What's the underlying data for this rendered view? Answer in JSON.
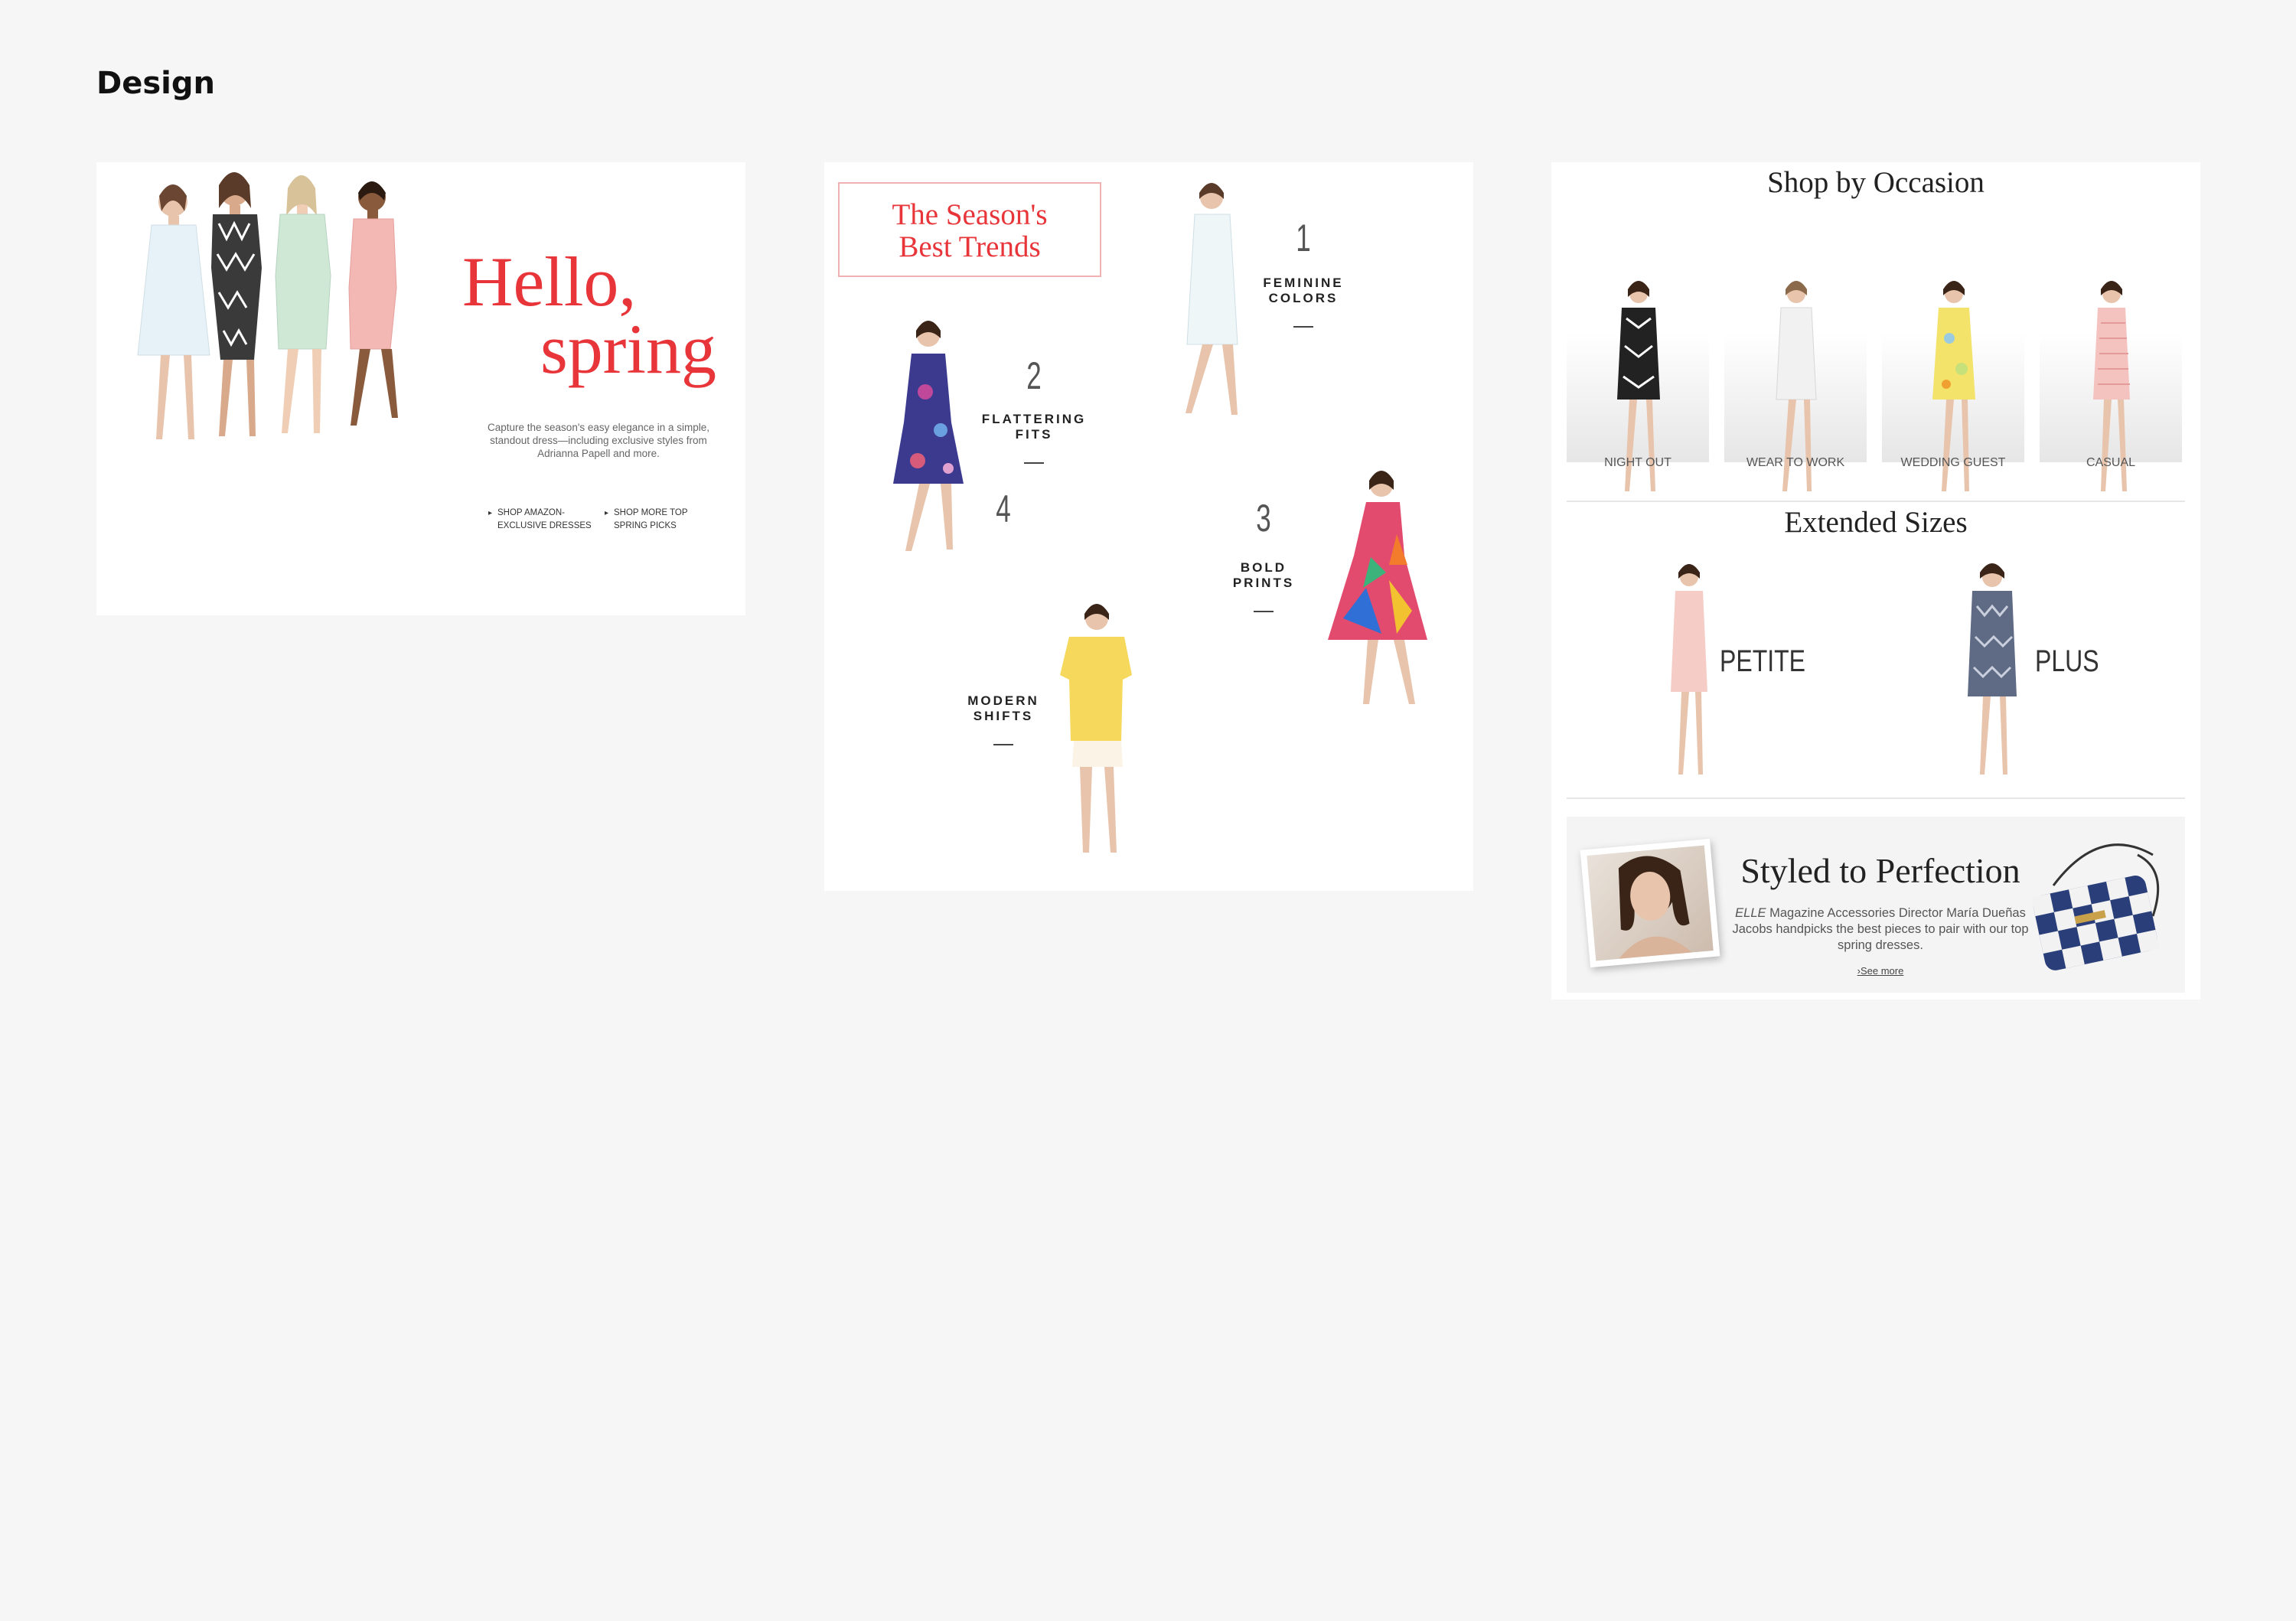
{
  "page": {
    "title": "Design"
  },
  "colors": {
    "accent_red": "#e8353a",
    "background": "#f6f6f6"
  },
  "hero": {
    "headline_line1": "Hello,",
    "headline_line2": "spring",
    "description": "Capture the season's easy elegance in a simple, standout dress—including exclusive styles from Adrianna Papell and more.",
    "link1": "Shop Amazon-Exclusive Dresses",
    "link2": "Shop More Top Spring Picks"
  },
  "trends": {
    "title_line1": "The Season's",
    "title_line2": "Best Trends",
    "items": [
      {
        "num": "1",
        "label": "FEMININE COLORS"
      },
      {
        "num": "2",
        "label": "FLATTERING FITS"
      },
      {
        "num": "3",
        "label": "BOLD PRINTS"
      },
      {
        "num": "4",
        "label": "MODERN SHIFTS"
      }
    ]
  },
  "occasion": {
    "heading": "Shop by Occasion",
    "items": [
      {
        "label": "NIGHT OUT"
      },
      {
        "label": "WEAR TO WORK"
      },
      {
        "label": "WEDDING GUEST"
      },
      {
        "label": "CASUAL"
      }
    ]
  },
  "extended": {
    "heading": "Extended Sizes",
    "petite": "PETITE",
    "plus": "PLUS"
  },
  "styled": {
    "heading": "Styled to Perfection",
    "desc_em": "ELLE",
    "desc_rest": " Magazine Accessories Director María Dueñas Jacobs handpicks the best pieces to pair with our top spring dresses.",
    "see_more": "›See more"
  }
}
